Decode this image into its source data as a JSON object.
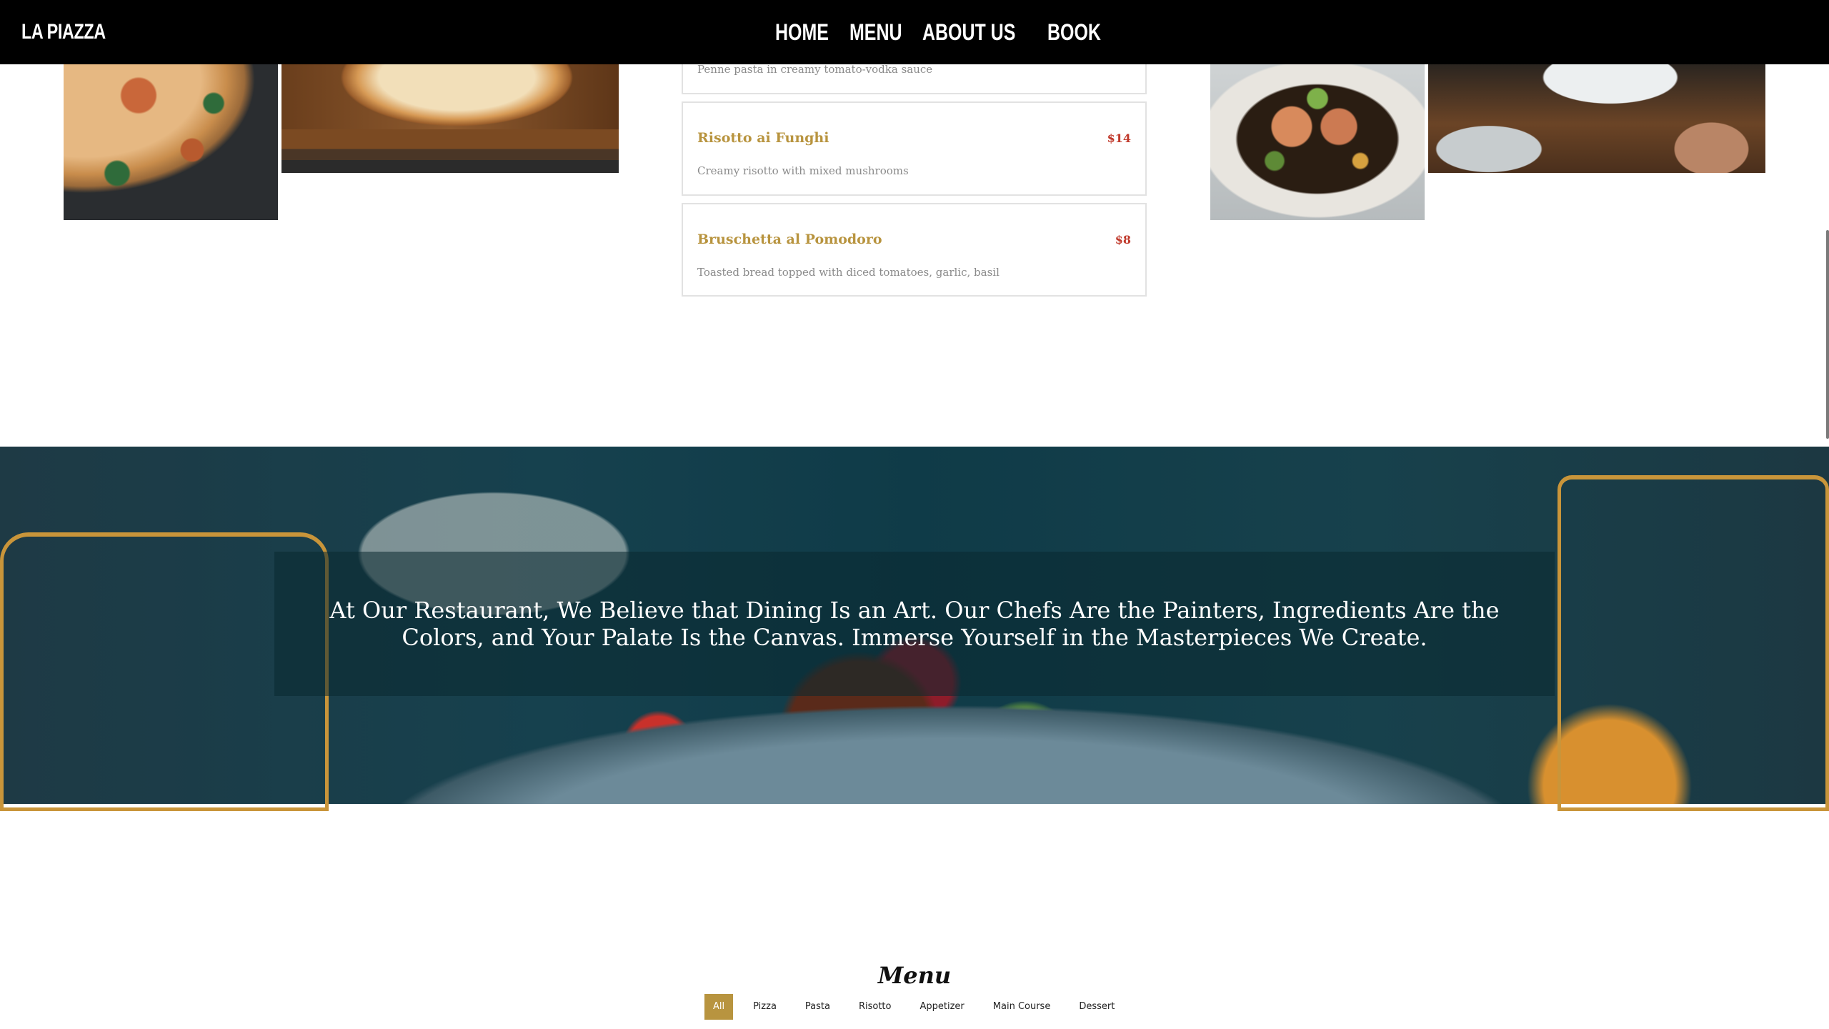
{
  "nav": {
    "brand": "LA PIAZZA",
    "links": [
      "HOME",
      "MENU",
      "ABOUT US",
      "BOOK"
    ]
  },
  "menu_cards": [
    {
      "name": "",
      "price": "",
      "description": "Penne pasta in creamy tomato-vodka sauce"
    },
    {
      "name": "Risotto ai Funghi",
      "price": "$14",
      "description": "Creamy risotto with mixed mushrooms"
    },
    {
      "name": "Bruschetta al Pomodoro",
      "price": "$8",
      "description": "Toasted bread topped with diced tomatoes, garlic, basil"
    }
  ],
  "hero": {
    "quote": "At Our Restaurant, We Believe that Dining Is an Art. Our Chefs Are the Painters, Ingredients Are the Colors, and Your Palate Is the Canvas. Immerse Yourself in the Masterpieces We Create."
  },
  "menu_section": {
    "title": "Menu",
    "filters": [
      "All",
      "Pizza",
      "Pasta",
      "Risotto",
      "Appetizer",
      "Main Course",
      "Dessert"
    ],
    "active_filter": "All"
  },
  "colors": {
    "accent_gold": "#b8943f",
    "price_red": "#c0392b",
    "nav_bg": "#000000"
  }
}
